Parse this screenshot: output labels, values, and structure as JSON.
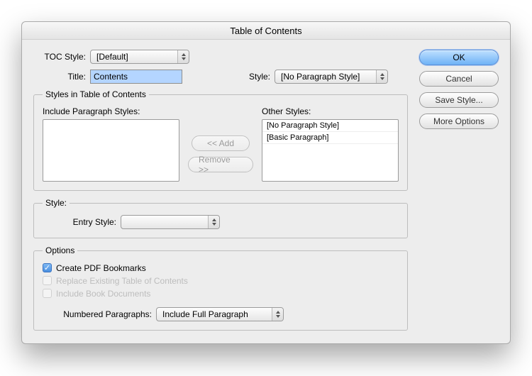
{
  "dialog": {
    "title": "Table of Contents"
  },
  "top": {
    "tocStyleLabel": "TOC Style:",
    "tocStyleValue": "[Default]",
    "titleLabel": "Title:",
    "titleValue": "Contents",
    "styleLabel": "Style:",
    "styleValue": "[No Paragraph Style]"
  },
  "stylesGroup": {
    "legend": "Styles in Table of Contents",
    "includeLabel": "Include Paragraph Styles:",
    "otherLabel": "Other Styles:",
    "otherItems": [
      "[No Paragraph Style]",
      "[Basic Paragraph]"
    ],
    "addLabel": "<< Add",
    "removeLabel": "Remove >>"
  },
  "styleGroup": {
    "legend": "Style:",
    "entryStyleLabel": "Entry Style:",
    "entryStyleValue": ""
  },
  "optionsGroup": {
    "legend": "Options",
    "createPdf": "Create PDF Bookmarks",
    "replace": "Replace Existing Table of Contents",
    "includeBook": "Include Book Documents",
    "numberedLabel": "Numbered Paragraphs:",
    "numberedValue": "Include Full Paragraph"
  },
  "buttons": {
    "ok": "OK",
    "cancel": "Cancel",
    "saveStyle": "Save Style...",
    "moreOptions": "More Options"
  }
}
